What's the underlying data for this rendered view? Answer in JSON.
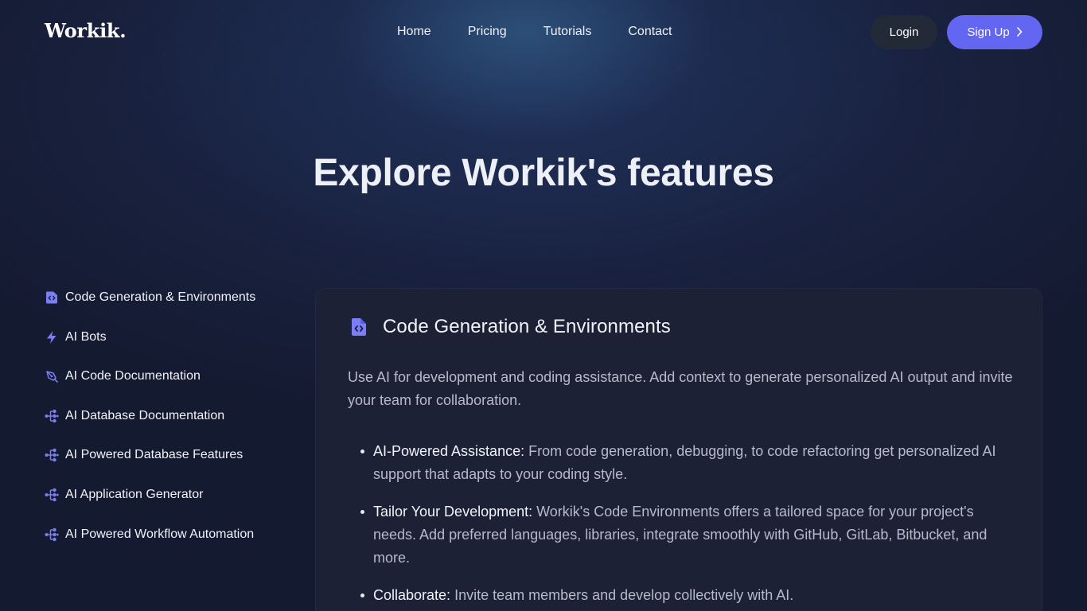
{
  "header": {
    "logo": "Workik.",
    "nav": [
      "Home",
      "Pricing",
      "Tutorials",
      "Contact"
    ],
    "login_label": "Login",
    "signup_label": "Sign Up"
  },
  "hero": {
    "title": "Explore Workik's features"
  },
  "sidebar": {
    "items": [
      {
        "label": "Code Generation & Environments",
        "icon": "code-file-icon"
      },
      {
        "label": "AI Bots",
        "icon": "lightning-icon"
      },
      {
        "label": "AI Code Documentation",
        "icon": "pen-nib-icon"
      },
      {
        "label": "AI Database Documentation",
        "icon": "hierarchy-icon"
      },
      {
        "label": "AI Powered Database Features",
        "icon": "hierarchy-icon"
      },
      {
        "label": "AI Application Generator",
        "icon": "hierarchy-icon"
      },
      {
        "label": "AI Powered Workflow Automation",
        "icon": "hierarchy-icon"
      }
    ]
  },
  "feature": {
    "icon": "code-file-icon",
    "title": "Code Generation & Environments",
    "description": "Use AI for development and coding assistance. Add context to generate personalized AI output and invite your team for collaboration.",
    "points": [
      {
        "title": "AI-Powered Assistance:",
        "text": " From code generation, debugging, to code refactoring get personalized AI support that adapts to your coding style."
      },
      {
        "title": "Tailor Your Development:",
        "text": " Workik's Code Environments offers a tailored space for your project's needs. Add preferred languages, libraries, integrate smoothly with GitHub, GitLab, Bitbucket, and more."
      },
      {
        "title": "Collaborate:",
        "text": " Invite team members and develop collectively with AI."
      }
    ]
  },
  "colors": {
    "accent": "#6366f1",
    "icon": "#7b7ff5",
    "background": "#141a30",
    "card": "#1c2136"
  }
}
